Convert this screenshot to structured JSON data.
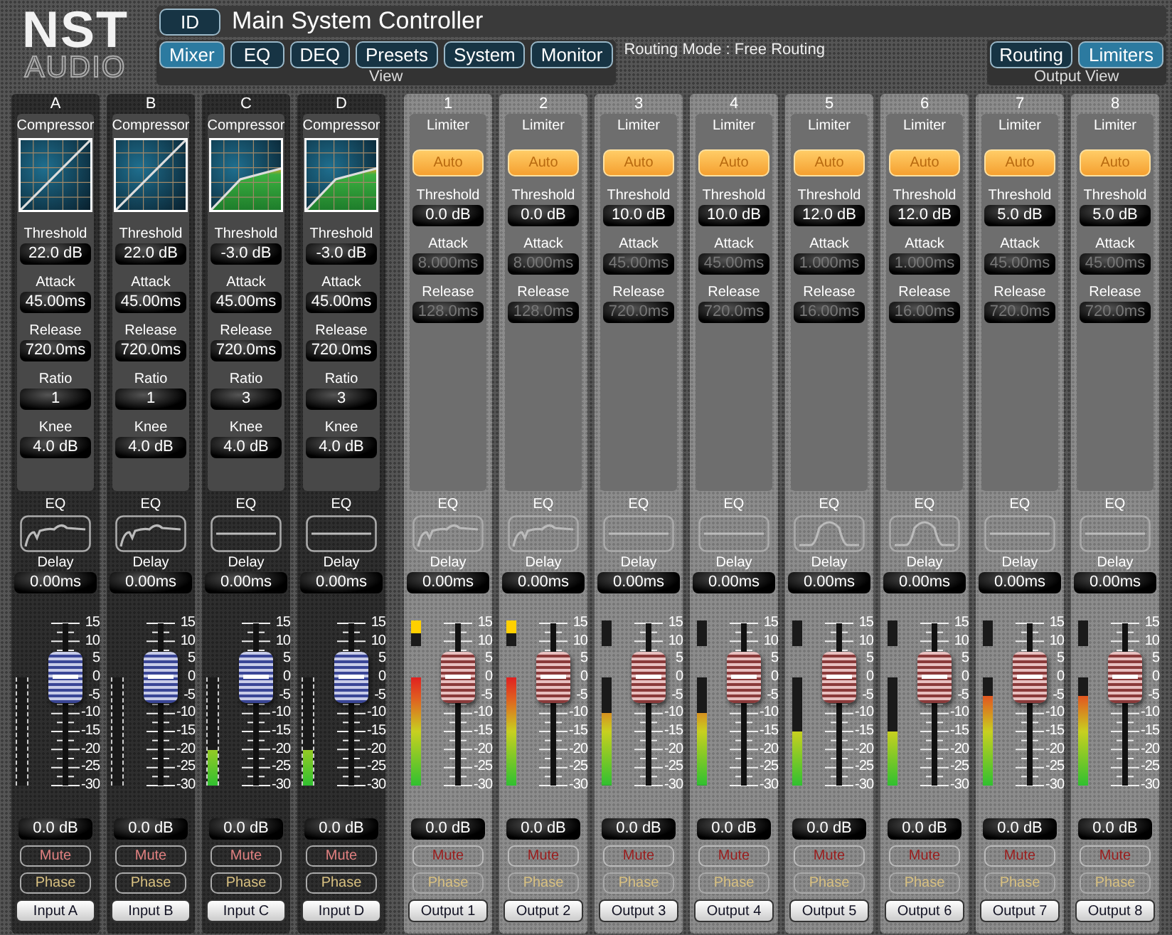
{
  "logo": {
    "wordmark": "NST",
    "subtitle": "AUDIO"
  },
  "id_button": "ID",
  "title": "Main System Controller",
  "view_tabs": [
    {
      "label": "Mixer",
      "selected": true
    },
    {
      "label": "EQ",
      "selected": false
    },
    {
      "label": "DEQ",
      "selected": false
    },
    {
      "label": "Presets",
      "selected": false
    },
    {
      "label": "System",
      "selected": false
    },
    {
      "label": "Monitor",
      "selected": false
    }
  ],
  "view_label": "View",
  "routing_mode": "Routing Mode : Free Routing",
  "output_view_tabs": [
    {
      "label": "Routing",
      "selected": false
    },
    {
      "label": "Limiters",
      "selected": true
    }
  ],
  "output_view_label": "Output View",
  "inputs": [
    {
      "header": "A",
      "section_title": "Compressor",
      "compressor_engaged": false,
      "params": [
        {
          "label": "Threshold",
          "value": "22.0 dB"
        },
        {
          "label": "Attack",
          "value": "45.00ms"
        },
        {
          "label": "Release",
          "value": "720.0ms"
        },
        {
          "label": "Ratio",
          "value": "1"
        },
        {
          "label": "Knee",
          "value": "4.0 dB"
        }
      ],
      "eq_label": "EQ",
      "eq_curve": {
        "kind": "lowcut"
      },
      "delay_label": "Delay",
      "delay": "0.00ms",
      "scale": [
        "15",
        "10",
        "5",
        "0",
        "-5",
        "-10",
        "-15",
        "-20",
        "-25",
        "-30"
      ],
      "fader": {
        "level": 0.667
      },
      "meter": {
        "level": 0
      },
      "gain": "0.0 dB",
      "mute": {
        "label": "Mute",
        "on": false
      },
      "phase": {
        "label": "Phase",
        "on": false
      },
      "name": "Input A"
    },
    {
      "header": "B",
      "section_title": "Compressor",
      "compressor_engaged": false,
      "params": [
        {
          "label": "Threshold",
          "value": "22.0 dB"
        },
        {
          "label": "Attack",
          "value": "45.00ms"
        },
        {
          "label": "Release",
          "value": "720.0ms"
        },
        {
          "label": "Ratio",
          "value": "1"
        },
        {
          "label": "Knee",
          "value": "4.0 dB"
        }
      ],
      "eq_label": "EQ",
      "eq_curve": {
        "kind": "lowcut"
      },
      "delay_label": "Delay",
      "delay": "0.00ms",
      "scale": [
        "15",
        "10",
        "5",
        "0",
        "-5",
        "-10",
        "-15",
        "-20",
        "-25",
        "-30"
      ],
      "fader": {
        "level": 0.667
      },
      "meter": {
        "level": 0
      },
      "gain": "0.0 dB",
      "mute": {
        "label": "Mute",
        "on": false
      },
      "phase": {
        "label": "Phase",
        "on": false
      },
      "name": "Input B"
    },
    {
      "header": "C",
      "section_title": "Compressor",
      "compressor_engaged": true,
      "params": [
        {
          "label": "Threshold",
          "value": "-3.0 dB"
        },
        {
          "label": "Attack",
          "value": "45.00ms"
        },
        {
          "label": "Release",
          "value": "720.0ms"
        },
        {
          "label": "Ratio",
          "value": "3"
        },
        {
          "label": "Knee",
          "value": "4.0 dB"
        }
      ],
      "eq_label": "EQ",
      "eq_curve": {
        "kind": "flat"
      },
      "delay_label": "Delay",
      "delay": "0.00ms",
      "scale": [
        "15",
        "10",
        "5",
        "0",
        "-5",
        "-10",
        "-15",
        "-20",
        "-25",
        "-30"
      ],
      "fader": {
        "level": 0.667
      },
      "meter": {
        "level": 0.33
      },
      "gain": "0.0 dB",
      "mute": {
        "label": "Mute",
        "on": false
      },
      "phase": {
        "label": "Phase",
        "on": false
      },
      "name": "Input C"
    },
    {
      "header": "D",
      "section_title": "Compressor",
      "compressor_engaged": true,
      "params": [
        {
          "label": "Threshold",
          "value": "-3.0 dB"
        },
        {
          "label": "Attack",
          "value": "45.00ms"
        },
        {
          "label": "Release",
          "value": "720.0ms"
        },
        {
          "label": "Ratio",
          "value": "3"
        },
        {
          "label": "Knee",
          "value": "4.0 dB"
        }
      ],
      "eq_label": "EQ",
      "eq_curve": {
        "kind": "flat"
      },
      "delay_label": "Delay",
      "delay": "0.00ms",
      "scale": [
        "15",
        "10",
        "5",
        "0",
        "-5",
        "-10",
        "-15",
        "-20",
        "-25",
        "-30"
      ],
      "fader": {
        "level": 0.667
      },
      "meter": {
        "level": 0.33
      },
      "gain": "0.0 dB",
      "mute": {
        "label": "Mute",
        "on": false
      },
      "phase": {
        "label": "Phase",
        "on": false
      },
      "name": "Input D"
    }
  ],
  "outputs": [
    {
      "header": "1",
      "section_title": "Limiter",
      "auto": {
        "label": "Auto",
        "on": true
      },
      "params": [
        {
          "label": "Threshold",
          "value": "0.0 dB",
          "disabled": false
        },
        {
          "label": "Attack",
          "value": "8.000ms",
          "disabled": true
        },
        {
          "label": "Release",
          "value": "128.0ms",
          "disabled": true
        }
      ],
      "eq_label": "EQ",
      "eq_curve": {
        "kind": "lowcut"
      },
      "delay_label": "Delay",
      "delay": "0.00ms",
      "scale": [
        "15",
        "10",
        "5",
        "0",
        "-5",
        "-10",
        "-15",
        "-20",
        "-25",
        "-30"
      ],
      "fader": {
        "level": 0.667
      },
      "meter": {
        "level": 1,
        "clip": true
      },
      "gain": "0.0 dB",
      "mute": {
        "label": "Mute",
        "on": false
      },
      "phase": {
        "label": "Phase",
        "on": false
      },
      "name": "Output 1"
    },
    {
      "header": "2",
      "section_title": "Limiter",
      "auto": {
        "label": "Auto",
        "on": true
      },
      "params": [
        {
          "label": "Threshold",
          "value": "0.0 dB",
          "disabled": false
        },
        {
          "label": "Attack",
          "value": "8.000ms",
          "disabled": true
        },
        {
          "label": "Release",
          "value": "128.0ms",
          "disabled": true
        }
      ],
      "eq_label": "EQ",
      "eq_curve": {
        "kind": "lowcut"
      },
      "delay_label": "Delay",
      "delay": "0.00ms",
      "scale": [
        "15",
        "10",
        "5",
        "0",
        "-5",
        "-10",
        "-15",
        "-20",
        "-25",
        "-30"
      ],
      "fader": {
        "level": 0.667
      },
      "meter": {
        "level": 1,
        "clip": true
      },
      "gain": "0.0 dB",
      "mute": {
        "label": "Mute",
        "on": false
      },
      "phase": {
        "label": "Phase",
        "on": false
      },
      "name": "Output 2"
    },
    {
      "header": "3",
      "section_title": "Limiter",
      "auto": {
        "label": "Auto",
        "on": true
      },
      "params": [
        {
          "label": "Threshold",
          "value": "10.0 dB",
          "disabled": false
        },
        {
          "label": "Attack",
          "value": "45.00ms",
          "disabled": true
        },
        {
          "label": "Release",
          "value": "720.0ms",
          "disabled": true
        }
      ],
      "eq_label": "EQ",
      "eq_curve": {
        "kind": "flat"
      },
      "delay_label": "Delay",
      "delay": "0.00ms",
      "scale": [
        "15",
        "10",
        "5",
        "0",
        "-5",
        "-10",
        "-15",
        "-20",
        "-25",
        "-30"
      ],
      "fader": {
        "level": 0.667
      },
      "meter": {
        "level": 0.67,
        "clip": false
      },
      "gain": "0.0 dB",
      "mute": {
        "label": "Mute",
        "on": false
      },
      "phase": {
        "label": "Phase",
        "on": false
      },
      "name": "Output 3"
    },
    {
      "header": "4",
      "section_title": "Limiter",
      "auto": {
        "label": "Auto",
        "on": true
      },
      "params": [
        {
          "label": "Threshold",
          "value": "10.0 dB",
          "disabled": false
        },
        {
          "label": "Attack",
          "value": "45.00ms",
          "disabled": true
        },
        {
          "label": "Release",
          "value": "720.0ms",
          "disabled": true
        }
      ],
      "eq_label": "EQ",
      "eq_curve": {
        "kind": "flat"
      },
      "delay_label": "Delay",
      "delay": "0.00ms",
      "scale": [
        "15",
        "10",
        "5",
        "0",
        "-5",
        "-10",
        "-15",
        "-20",
        "-25",
        "-30"
      ],
      "fader": {
        "level": 0.667
      },
      "meter": {
        "level": 0.67,
        "clip": false
      },
      "gain": "0.0 dB",
      "mute": {
        "label": "Mute",
        "on": false
      },
      "phase": {
        "label": "Phase",
        "on": false
      },
      "name": "Output 4"
    },
    {
      "header": "5",
      "section_title": "Limiter",
      "auto": {
        "label": "Auto",
        "on": true
      },
      "params": [
        {
          "label": "Threshold",
          "value": "12.0 dB",
          "disabled": false
        },
        {
          "label": "Attack",
          "value": "1.000ms",
          "disabled": true
        },
        {
          "label": "Release",
          "value": "16.00ms",
          "disabled": true
        }
      ],
      "eq_label": "EQ",
      "eq_curve": {
        "kind": "bump"
      },
      "delay_label": "Delay",
      "delay": "0.00ms",
      "scale": [
        "15",
        "10",
        "5",
        "0",
        "-5",
        "-10",
        "-15",
        "-20",
        "-25",
        "-30"
      ],
      "fader": {
        "level": 0.667
      },
      "meter": {
        "level": 0.5,
        "clip": false
      },
      "gain": "0.0 dB",
      "mute": {
        "label": "Mute",
        "on": false
      },
      "phase": {
        "label": "Phase",
        "on": false
      },
      "name": "Output 5"
    },
    {
      "header": "6",
      "section_title": "Limiter",
      "auto": {
        "label": "Auto",
        "on": true
      },
      "params": [
        {
          "label": "Threshold",
          "value": "12.0 dB",
          "disabled": false
        },
        {
          "label": "Attack",
          "value": "1.000ms",
          "disabled": true
        },
        {
          "label": "Release",
          "value": "16.00ms",
          "disabled": true
        }
      ],
      "eq_label": "EQ",
      "eq_curve": {
        "kind": "bump"
      },
      "delay_label": "Delay",
      "delay": "0.00ms",
      "scale": [
        "15",
        "10",
        "5",
        "0",
        "-5",
        "-10",
        "-15",
        "-20",
        "-25",
        "-30"
      ],
      "fader": {
        "level": 0.667
      },
      "meter": {
        "level": 0.5,
        "clip": false
      },
      "gain": "0.0 dB",
      "mute": {
        "label": "Mute",
        "on": false
      },
      "phase": {
        "label": "Phase",
        "on": false
      },
      "name": "Output 6"
    },
    {
      "header": "7",
      "section_title": "Limiter",
      "auto": {
        "label": "Auto",
        "on": true
      },
      "params": [
        {
          "label": "Threshold",
          "value": "5.0 dB",
          "disabled": false
        },
        {
          "label": "Attack",
          "value": "45.00ms",
          "disabled": true
        },
        {
          "label": "Release",
          "value": "720.0ms",
          "disabled": true
        }
      ],
      "eq_label": "EQ",
      "eq_curve": {
        "kind": "flat"
      },
      "delay_label": "Delay",
      "delay": "0.00ms",
      "scale": [
        "15",
        "10",
        "5",
        "0",
        "-5",
        "-10",
        "-15",
        "-20",
        "-25",
        "-30"
      ],
      "fader": {
        "level": 0.667
      },
      "meter": {
        "level": 0.83,
        "clip": false
      },
      "gain": "0.0 dB",
      "mute": {
        "label": "Mute",
        "on": false
      },
      "phase": {
        "label": "Phase",
        "on": false
      },
      "name": "Output 7"
    },
    {
      "header": "8",
      "section_title": "Limiter",
      "auto": {
        "label": "Auto",
        "on": true
      },
      "params": [
        {
          "label": "Threshold",
          "value": "5.0 dB",
          "disabled": false
        },
        {
          "label": "Attack",
          "value": "45.00ms",
          "disabled": true
        },
        {
          "label": "Release",
          "value": "720.0ms",
          "disabled": true
        }
      ],
      "eq_label": "EQ",
      "eq_curve": {
        "kind": "flat"
      },
      "delay_label": "Delay",
      "delay": "0.00ms",
      "scale": [
        "15",
        "10",
        "5",
        "0",
        "-5",
        "-10",
        "-15",
        "-20",
        "-25",
        "-30"
      ],
      "fader": {
        "level": 0.667
      },
      "meter": {
        "level": 0.83,
        "clip": false
      },
      "gain": "0.0 dB",
      "mute": {
        "label": "Mute",
        "on": false
      },
      "phase": {
        "label": "Phase",
        "on": false
      },
      "name": "Output 8"
    }
  ]
}
